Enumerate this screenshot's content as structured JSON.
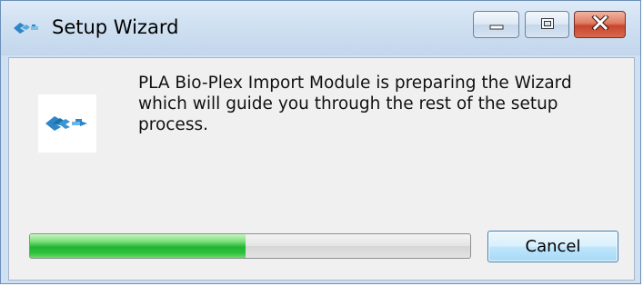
{
  "window": {
    "title": "Setup Wizard",
    "controls": {
      "minimize": "minimize-icon",
      "maximize": "maximize-icon",
      "close": "close-icon"
    }
  },
  "content": {
    "logo_icon": "app-logo-icon",
    "message": "PLA Bio-Plex Import Module is preparing the Wizard which will guide you through the rest of the setup process."
  },
  "progress": {
    "value_percent": 49,
    "fill_color": "#21b431"
  },
  "buttons": {
    "cancel_label": "Cancel"
  },
  "colors": {
    "title_bar": "#cfe0f1",
    "close_button": "#c6452c",
    "panel_background": "#f0f0f0",
    "logo_accent": "#2e86c8"
  }
}
